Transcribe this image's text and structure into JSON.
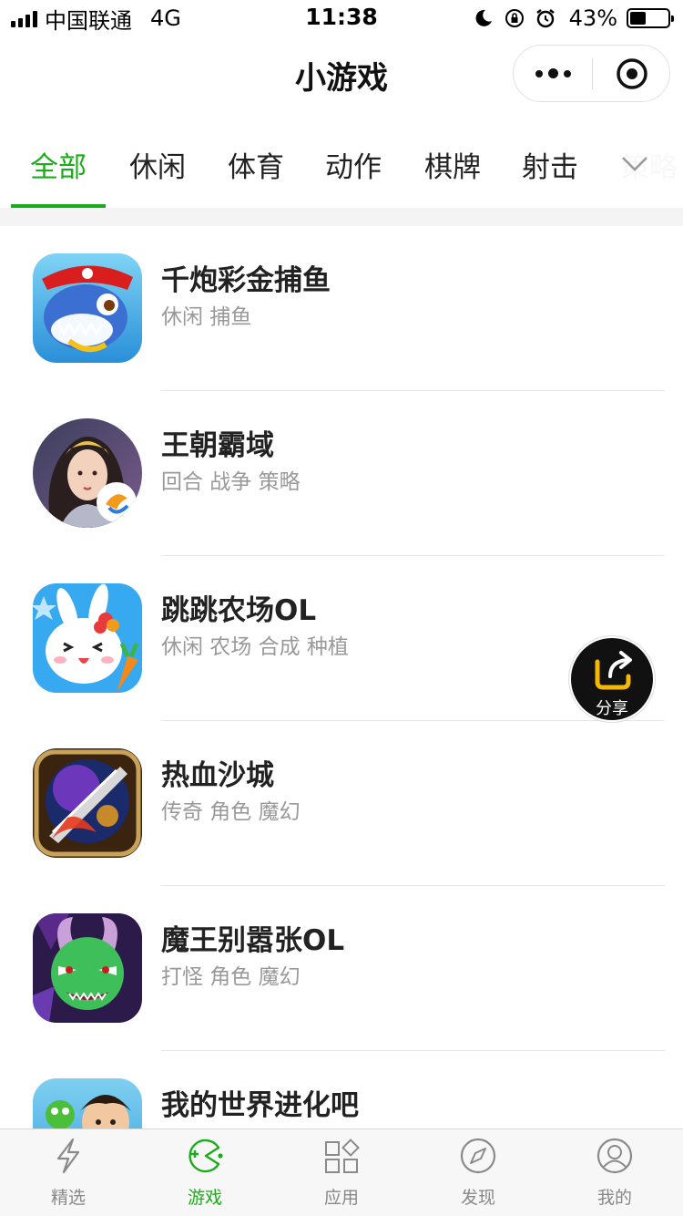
{
  "status_bar": {
    "carrier": "中国联通",
    "network": "4G",
    "time": "11:38",
    "battery_percent": "43%",
    "battery_level": 0.43
  },
  "nav": {
    "title": "小游戏"
  },
  "tabs": [
    {
      "label": "全部",
      "active": true
    },
    {
      "label": "休闲"
    },
    {
      "label": "体育"
    },
    {
      "label": "动作"
    },
    {
      "label": "棋牌"
    },
    {
      "label": "射击"
    },
    {
      "label": "策略"
    }
  ],
  "games": [
    {
      "name": "千炮彩金捕鱼",
      "tags": "休闲 捕鱼"
    },
    {
      "name": "王朝霸域",
      "tags": "回合 战争 策略"
    },
    {
      "name": "跳跳农场OL",
      "tags": "休闲 农场 合成 种植"
    },
    {
      "name": "热血沙城",
      "tags": "传奇 角色 魔幻"
    },
    {
      "name": "魔王别嚣张OL",
      "tags": "打怪 角色 魔幻"
    },
    {
      "name": "我的世界进化吧",
      "tags": ""
    }
  ],
  "share": {
    "label": "分享"
  },
  "tab_bar": [
    {
      "label": "精选",
      "icon": "lightning-icon"
    },
    {
      "label": "游戏",
      "icon": "game-icon",
      "active": true
    },
    {
      "label": "应用",
      "icon": "apps-icon"
    },
    {
      "label": "发现",
      "icon": "compass-icon"
    },
    {
      "label": "我的",
      "icon": "profile-icon"
    }
  ],
  "colors": {
    "accent": "#1aad19",
    "share_icon": "#f5b800"
  }
}
